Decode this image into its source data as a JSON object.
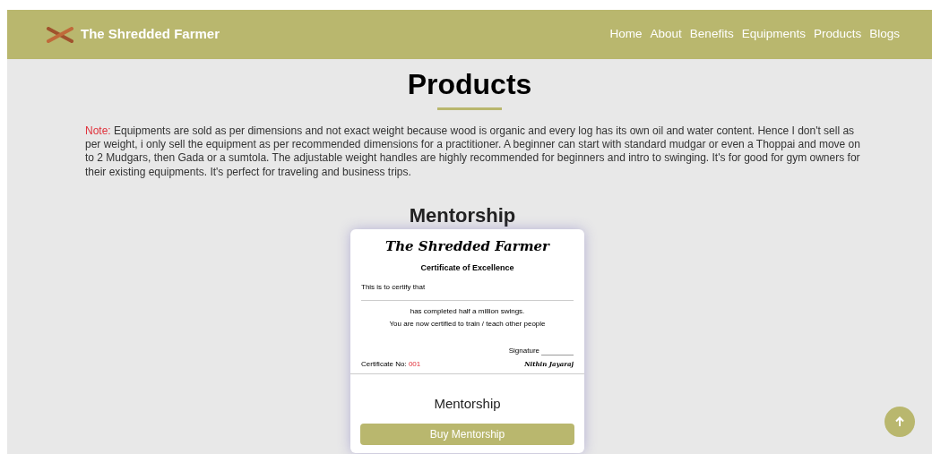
{
  "brand": "The Shredded Farmer",
  "nav": [
    {
      "label": "Home"
    },
    {
      "label": "About"
    },
    {
      "label": "Benefits"
    },
    {
      "label": "Equipments"
    },
    {
      "label": "Products"
    },
    {
      "label": "Blogs"
    }
  ],
  "title": "Products",
  "note": {
    "label": "Note:",
    "text": "Equipments are sold as per dimensions and not exact weight because wood is organic and every log has its own oil and water content. Hence I don't sell as per weight, i only sell the equipment as per recommended dimensions for a practitioner. A beginner can start with standard mudgar or even a Thoppai and move on to 2 Mudgars, then Gada or a sumtola. The adjustable weight handles are highly recommended for beginners and intro to swinging. It's for good for gym owners for their existing equipments. It's perfect for traveling and business trips."
  },
  "section_title": "Mentorship",
  "product": {
    "certificate": {
      "logo": "The Shredded Farmer",
      "heading": "Certificate of Excellence",
      "intro": "This is to certify that",
      "line_1": "has completed half a million swings.",
      "line_2": "You are now certified to train / teach other people",
      "signature_label": "Signature",
      "number_label": "Certificate No:",
      "number": "001",
      "signer": "Nithin Jayaraj"
    },
    "name": "Mentorship",
    "button": "Buy Mentorship"
  }
}
